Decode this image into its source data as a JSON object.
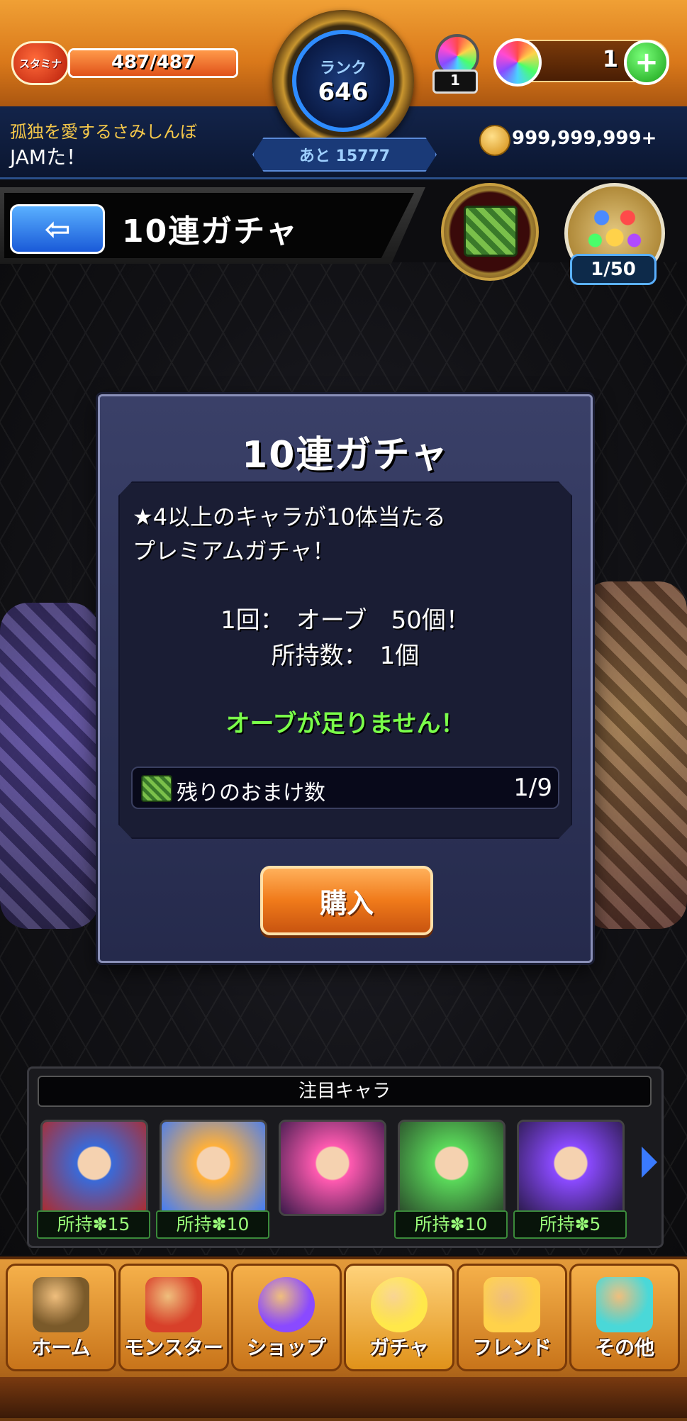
{
  "header": {
    "stamina_label": "スタミナ",
    "stamina_value": "487/487",
    "stamina_fraction": 1.0,
    "rank_label": "ランク",
    "rank_value": "646",
    "rank_next": "あと 15777",
    "orb_badge_count": "1",
    "orb_count": "1",
    "plus_label": "+",
    "user_title": "孤独を愛するさみしんぼ",
    "user_name": "JAMた！",
    "coins": "999,999,999+"
  },
  "titlebar": {
    "back_label": "⇦",
    "title": "10連ガチャ",
    "medal_count": "1/50"
  },
  "dialog": {
    "title": "10連ガチャ",
    "description_line1": "★4以上のキャラが10体当たる",
    "description_line2": "プレミアムガチャ！",
    "cost": "1回：　オーブ　50個！",
    "held": "所持数：　1個",
    "warning": "オーブが足りません！",
    "bonus_label": "残りのおまけ数",
    "bonus_value": "1/9",
    "buy_label": "購入"
  },
  "featured": {
    "title": "注目キャラ",
    "chars": [
      {
        "held": "所持✽15",
        "color_a": "#3a6ad8",
        "color_b": "#b02a2a"
      },
      {
        "held": "所持✽10",
        "color_a": "#ffb03a",
        "color_b": "#3a7aff"
      },
      {
        "held": "",
        "color_a": "#ff5ab0",
        "color_b": "#3a1a4a"
      },
      {
        "held": "所持✽10",
        "color_a": "#5ad85a",
        "color_b": "#2a4a2a"
      },
      {
        "held": "所持✽5",
        "color_a": "#8a4aff",
        "color_b": "#2a1a4a"
      }
    ]
  },
  "nav": {
    "items": [
      {
        "label": "ホーム",
        "icon": "home-gate-icon",
        "color": "#7a5a2a"
      },
      {
        "label": "モンスター",
        "icon": "dragon-icon",
        "color": "#d8402a"
      },
      {
        "label": "ショップ",
        "icon": "rainbow-orb-icon",
        "color": "#8a4aff"
      },
      {
        "label": "ガチャ",
        "icon": "gacha-bird-icon",
        "color": "#ffe84a"
      },
      {
        "label": "フレンド",
        "icon": "balloons-icon",
        "color": "#ffd24a"
      },
      {
        "label": "その他",
        "icon": "question-icon",
        "color": "#4ad8d8"
      }
    ]
  },
  "colors": {
    "accent_orange": "#f07a1a",
    "accent_blue": "#2e8cff",
    "warning_green": "#7aff4a"
  }
}
